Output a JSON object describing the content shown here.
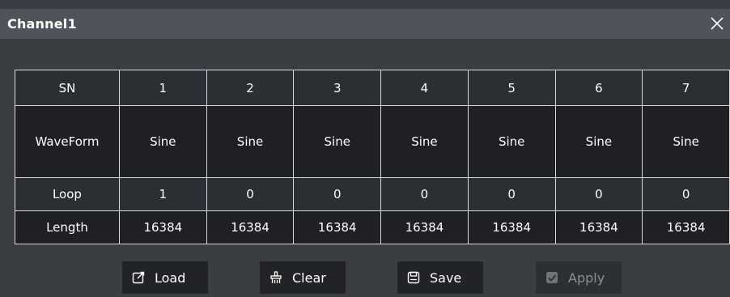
{
  "dialog": {
    "title": "Channel1"
  },
  "table": {
    "header": [
      "SN",
      "1",
      "2",
      "3",
      "4",
      "5",
      "6",
      "7"
    ],
    "rows": {
      "waveform": [
        "WaveForm",
        "Sine",
        "Sine",
        "Sine",
        "Sine",
        "Sine",
        "Sine",
        "Sine"
      ],
      "loop": [
        "Loop",
        "1",
        "0",
        "0",
        "0",
        "0",
        "0",
        "0"
      ],
      "length": [
        "Length",
        "16384",
        "16384",
        "16384",
        "16384",
        "16384",
        "16384",
        "16384"
      ]
    }
  },
  "buttons": {
    "load": "Load",
    "clear": "Clear",
    "save": "Save",
    "apply": "Apply"
  },
  "icons": {
    "close": "close-icon",
    "load": "load-icon",
    "clear": "clear-icon",
    "save": "save-icon",
    "apply": "apply-check-icon"
  },
  "colors": {
    "background": "#3a3d41",
    "titlebar": "#50545a",
    "cell_dark": "#1e2023",
    "cell_mid": "#2b2e32",
    "button": "#212326",
    "grid_line": "#d9d9d9"
  }
}
